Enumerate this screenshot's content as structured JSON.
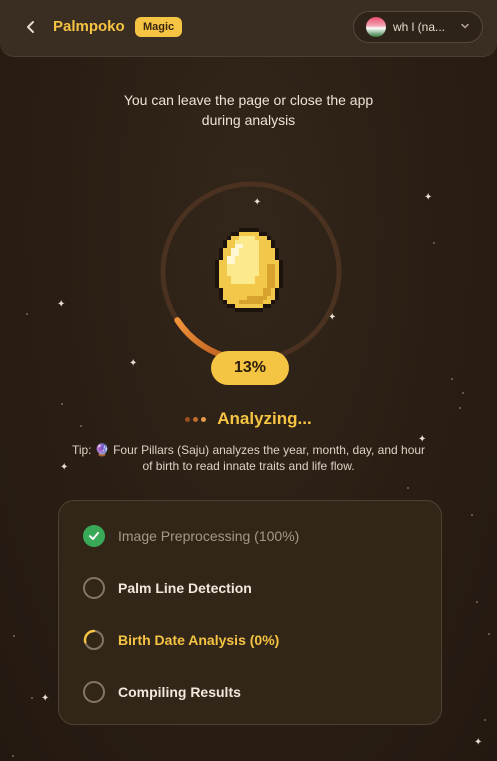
{
  "header": {
    "back_label": "Back",
    "app_name": "Palmpoko",
    "badge": "Magic",
    "profile_name": "wh l (na..."
  },
  "notice": {
    "line1": "You can leave the page or close the app",
    "line2": "during analysis"
  },
  "progress": {
    "percent_label": "13%",
    "value": 0.13
  },
  "status": {
    "label": "Analyzing..."
  },
  "tip": {
    "text": "Tip: 🔮 Four Pillars (Saju) analyzes the year, month, day, and hour of birth to read innate traits and life flow."
  },
  "steps": [
    {
      "label": "Image Preprocessing (100%)",
      "state": "done"
    },
    {
      "label": "Palm Line Detection",
      "state": "pending"
    },
    {
      "label": "Birth Date Analysis (0%)",
      "state": "active"
    },
    {
      "label": "Compiling Results",
      "state": "pending"
    }
  ],
  "colors": {
    "accent": "#f6c443",
    "background": "#2b1f15",
    "ring_progress": "#e07a2c",
    "success": "#3aa957"
  },
  "icons": {
    "back": "chevron-left-icon",
    "profile_caret": "chevron-down-icon",
    "done": "check-icon",
    "pending": "empty-circle-icon",
    "active": "spinner-icon",
    "mascot": "golden-egg-pixel"
  }
}
